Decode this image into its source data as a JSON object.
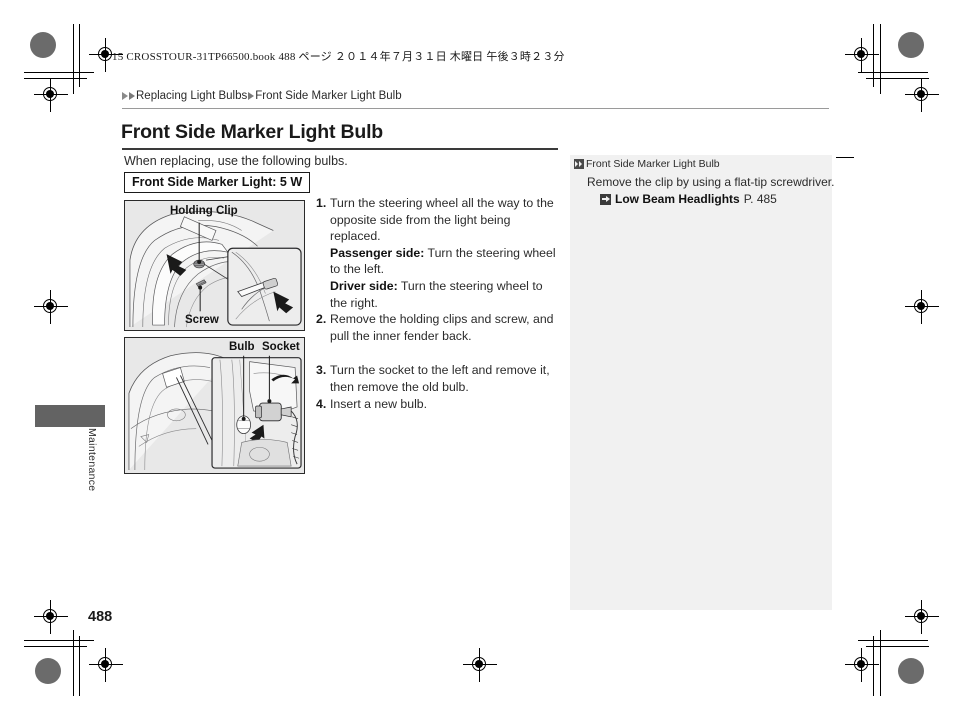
{
  "print_slug": "15 CROSSTOUR-31TP66500.book   488 ページ   ２０１４年７月３１日   木曜日   午後３時２３分",
  "breadcrumb": {
    "item1": "Replacing Light Bulbs",
    "item2": "Front Side Marker Light Bulb"
  },
  "page_title": "Front Side Marker Light Bulb",
  "intro": "When replacing, use the following bulbs.",
  "spec_box": "Front Side Marker Light: 5 W",
  "illustrations": [
    {
      "name": "fender-liner-clip-screw",
      "labels": [
        {
          "text": "Holding Clip"
        },
        {
          "text": "Screw"
        }
      ]
    },
    {
      "name": "bulb-socket-detail",
      "labels": [
        {
          "text": "Bulb"
        },
        {
          "text": "Socket"
        }
      ]
    }
  ],
  "steps": [
    {
      "num": "1.",
      "lines": [
        {
          "type": "plain",
          "text": "Turn the steering wheel all the way to the opposite side from the light being replaced."
        },
        {
          "type": "lead",
          "lead": "Passenger side:",
          "text": " Turn the steering wheel to the left."
        },
        {
          "type": "lead",
          "lead": "Driver side:",
          "text": " Turn the steering wheel to the right."
        }
      ]
    },
    {
      "num": "2.",
      "lines": [
        {
          "type": "plain",
          "text": "Remove the holding clips and screw, and pull the inner fender back."
        }
      ]
    },
    {
      "num": "3.",
      "lines": [
        {
          "type": "plain",
          "text": "Turn the socket to the left and remove it, then remove the old bulb."
        }
      ]
    },
    {
      "num": "4.",
      "lines": [
        {
          "type": "plain",
          "text": "Insert a new bulb."
        }
      ]
    }
  ],
  "info_panel": {
    "heading": "Front Side Marker Light Bulb",
    "body": "Remove the clip by using a flat-tip screwdriver.",
    "reference_label": "Low Beam Headlights",
    "reference_page": "P. 485",
    "background_color": "#f1f1f1"
  },
  "side_tab": {
    "label": "Maintenance",
    "color": "#636363"
  },
  "page_number": "488"
}
